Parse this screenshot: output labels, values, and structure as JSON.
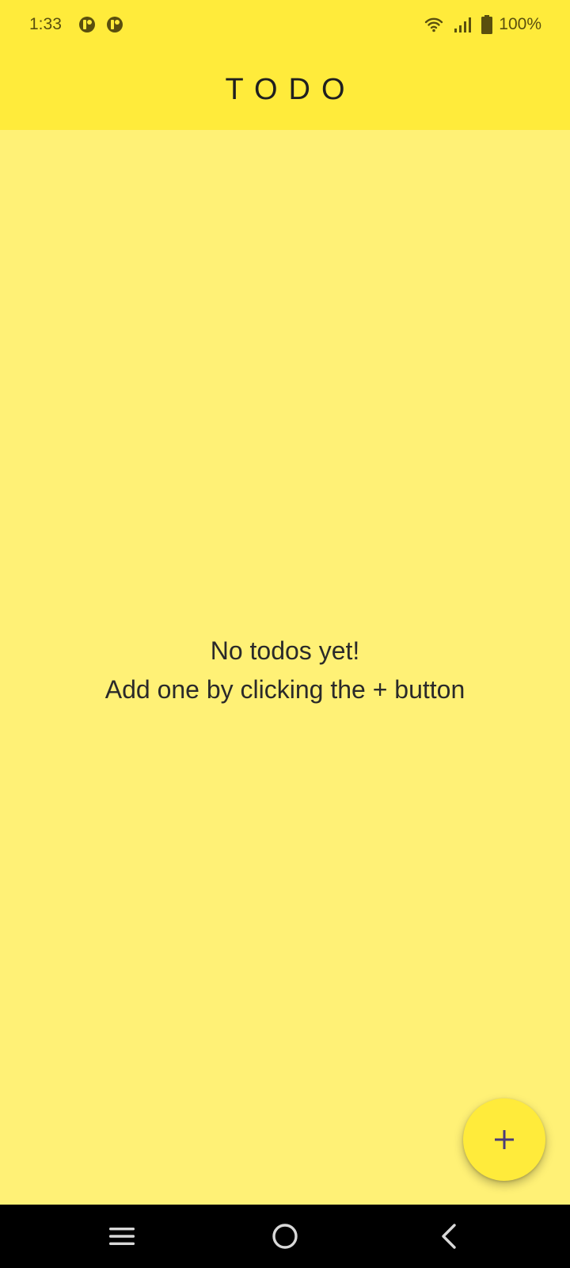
{
  "status_bar": {
    "time": "1:33",
    "battery": "100%",
    "icons": [
      "notification-icon",
      "notification-icon",
      "wifi-icon",
      "signal-icon",
      "battery-icon"
    ]
  },
  "app_bar": {
    "title": "TODO"
  },
  "empty_state": {
    "line1": "No todos yet!",
    "line2": "Add one by clicking the + button"
  },
  "fab": {
    "icon": "plus-icon"
  },
  "nav_bar": {
    "icons": [
      "menu-icon",
      "home-icon",
      "back-icon"
    ]
  },
  "colors": {
    "app_bar": "#FFEB3B",
    "background": "#FFF176",
    "fab": "#FFEB3B",
    "fab_icon": "#4A3B78",
    "nav_bar": "#000000"
  }
}
